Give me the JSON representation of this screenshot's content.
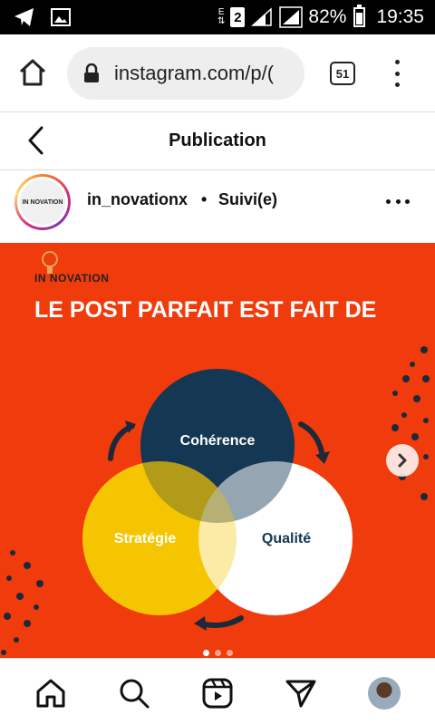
{
  "status_bar": {
    "battery": "82%",
    "time": "19:35",
    "sim": "2",
    "network_glyph": "E"
  },
  "browser": {
    "url": "instagram.com/p/(",
    "tab_count": "51"
  },
  "page_header": {
    "title": "Publication"
  },
  "post": {
    "username": "in_novationx",
    "separator": "•",
    "follow_status": "Suivi(e)",
    "avatar_text": "IN NOVATION",
    "image": {
      "brand": "IN NOVATION",
      "headline": "LE POST PARFAIT EST FAIT DE",
      "circles": {
        "top": "Cohérence",
        "left": "Stratégie",
        "right": "Qualité"
      },
      "colors": {
        "background": "#f03b0c",
        "top_circle": "#143754",
        "left_circle": "#f6c502",
        "right_circle": "#ffffff"
      },
      "carousel_total": 3,
      "carousel_active": 1
    }
  },
  "bottom_nav": {
    "items": [
      "home-icon",
      "search-icon",
      "reels-icon",
      "send-icon",
      "profile-avatar"
    ]
  }
}
